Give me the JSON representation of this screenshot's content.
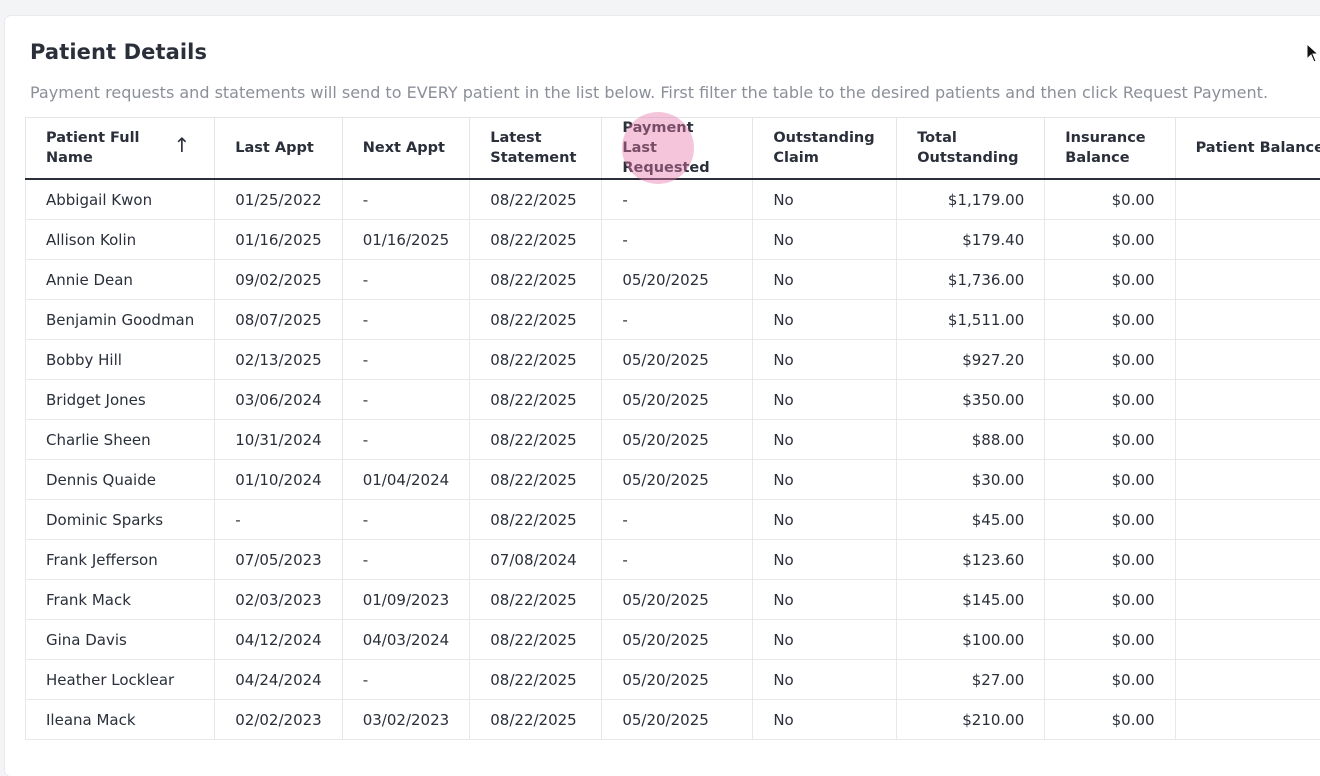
{
  "page": {
    "title": "Patient Details",
    "subtitle": "Payment requests and statements will send to EVERY patient in the list below. First filter the table to the desired patients and then click Request Payment."
  },
  "icons": {
    "sort": "sort-ascending-icon",
    "cursor": "mouse-pointer-icon"
  },
  "table": {
    "sort_arrow": "↑",
    "columns": [
      "Patient Full Name",
      "Last Appt",
      "Next Appt",
      "Latest Statement",
      "Payment Last Requested",
      "Outstanding Claim",
      "Total Outstanding",
      "Insurance Balance",
      "Patient Balance"
    ],
    "rows": [
      [
        "Abbigail Kwon",
        "01/25/2022",
        "-",
        "08/22/2025",
        "-",
        "No",
        "$1,179.00",
        "$0.00",
        ""
      ],
      [
        "Allison Kolin",
        "01/16/2025",
        "01/16/2025",
        "08/22/2025",
        "-",
        "No",
        "$179.40",
        "$0.00",
        ""
      ],
      [
        "Annie Dean",
        "09/02/2025",
        "-",
        "08/22/2025",
        "05/20/2025",
        "No",
        "$1,736.00",
        "$0.00",
        ""
      ],
      [
        "Benjamin Goodman",
        "08/07/2025",
        "-",
        "08/22/2025",
        "-",
        "No",
        "$1,511.00",
        "$0.00",
        ""
      ],
      [
        "Bobby Hill",
        "02/13/2025",
        "-",
        "08/22/2025",
        "05/20/2025",
        "No",
        "$927.20",
        "$0.00",
        ""
      ],
      [
        "Bridget Jones",
        "03/06/2024",
        "-",
        "08/22/2025",
        "05/20/2025",
        "No",
        "$350.00",
        "$0.00",
        ""
      ],
      [
        "Charlie Sheen",
        "10/31/2024",
        "-",
        "08/22/2025",
        "05/20/2025",
        "No",
        "$88.00",
        "$0.00",
        ""
      ],
      [
        "Dennis Quaide",
        "01/10/2024",
        "01/04/2024",
        "08/22/2025",
        "05/20/2025",
        "No",
        "$30.00",
        "$0.00",
        ""
      ],
      [
        "Dominic Sparks",
        "-",
        "-",
        "08/22/2025",
        "-",
        "No",
        "$45.00",
        "$0.00",
        ""
      ],
      [
        "Frank Jefferson",
        "07/05/2023",
        "-",
        "07/08/2024",
        "-",
        "No",
        "$123.60",
        "$0.00",
        ""
      ],
      [
        "Frank Mack",
        "02/03/2023",
        "01/09/2023",
        "08/22/2025",
        "05/20/2025",
        "No",
        "$145.00",
        "$0.00",
        ""
      ],
      [
        "Gina Davis",
        "04/12/2024",
        "04/03/2024",
        "08/22/2025",
        "05/20/2025",
        "No",
        "$100.00",
        "$0.00",
        ""
      ],
      [
        "Heather Locklear",
        "04/24/2024",
        "-",
        "08/22/2025",
        "05/20/2025",
        "No",
        "$27.00",
        "$0.00",
        ""
      ],
      [
        "Ileana Mack",
        "02/02/2023",
        "03/02/2023",
        "08/22/2025",
        "05/20/2025",
        "No",
        "$210.00",
        "$0.00",
        ""
      ]
    ]
  }
}
